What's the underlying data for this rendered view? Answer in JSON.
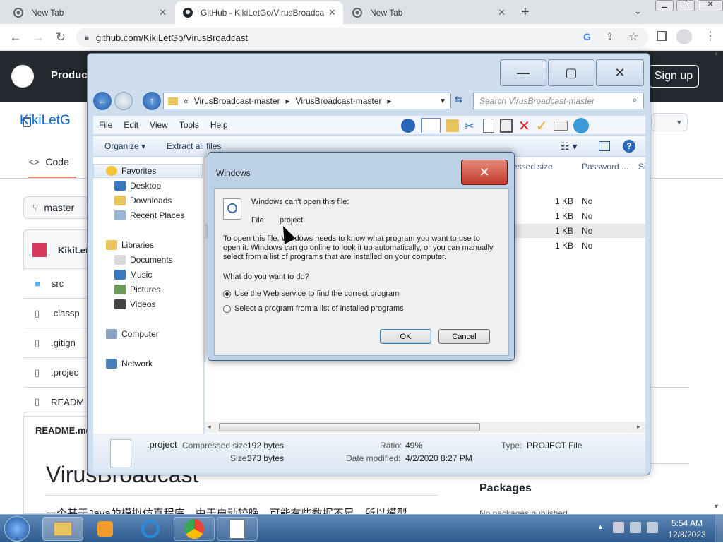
{
  "browser": {
    "tabs": [
      {
        "label": "New Tab"
      },
      {
        "label": "GitHub - KikiLetGo/VirusBroadca"
      },
      {
        "label": "New Tab"
      }
    ],
    "url": "github.com/KikiLetGo/VirusBroadcast"
  },
  "github": {
    "product_label": "Produc",
    "signin": "Sign up",
    "repo_title": "KikiLetG",
    "code_tab": "Code",
    "branch": "master",
    "owner_short": "KikiLet",
    "files": [
      ".classp",
      ".gitign",
      ".projec",
      "READM"
    ],
    "src": "src",
    "readme_label": "README.md",
    "heading": "VirusBroadcast",
    "packages": "Packages",
    "no_packages": "No packages published",
    "cjk_line": "一个基于Java的模拟仿真程序。由于启动较晚，可能有些数据不足，所以模型"
  },
  "explorer": {
    "path": [
      "VirusBroadcast-master",
      "VirusBroadcast-master"
    ],
    "search_placeholder": "Search VirusBroadcast-master",
    "menu": [
      "File",
      "Edit",
      "View",
      "Tools",
      "Help"
    ],
    "commands": {
      "organize": "Organize",
      "extract": "Extract all files"
    },
    "nav": {
      "favorites": "Favorites",
      "desktop": "Desktop",
      "downloads": "Downloads",
      "recent": "Recent Places",
      "libraries": "Libraries",
      "documents": "Documents",
      "music": "Music",
      "pictures": "Pictures",
      "videos": "Videos",
      "computer": "Computer",
      "network": "Network"
    },
    "columns": {
      "compressed": "ressed size",
      "password": "Password ...",
      "size": "Si"
    },
    "rows": [
      {
        "size": "1 KB",
        "password": "No"
      },
      {
        "size": "1 KB",
        "password": "No"
      },
      {
        "size": "1 KB",
        "password": "No"
      },
      {
        "size": "1 KB",
        "password": "No"
      }
    ],
    "details": {
      "name": ".project",
      "compressed_label": "Compressed size:",
      "compressed_value": "192 bytes",
      "size_label": "Size:",
      "size_value": "373 bytes",
      "ratio_label": "Ratio:",
      "ratio_value": "49%",
      "modified_label": "Date modified:",
      "modified_value": "4/2/2020 8:27 PM",
      "type_label": "Type:",
      "type_value": "PROJECT File"
    }
  },
  "dialog": {
    "title": "Windows",
    "line1": "Windows can't open this file:",
    "file_label": "File:",
    "file_value": ".project",
    "body1": "To open this file, Windows needs to know what program you want to use to",
    "body2": "open it. Windows can go online to look it up automatically, or you can manually",
    "body3": "select from a list of programs that are installed on your computer.",
    "question": "What do you want to do?",
    "opt1": "Use the Web service to find the correct program",
    "opt2": "Select a program from a list of installed programs",
    "ok": "OK",
    "cancel": "Cancel"
  },
  "taskbar": {
    "time": "5:54 AM",
    "date": "12/8/2023"
  }
}
